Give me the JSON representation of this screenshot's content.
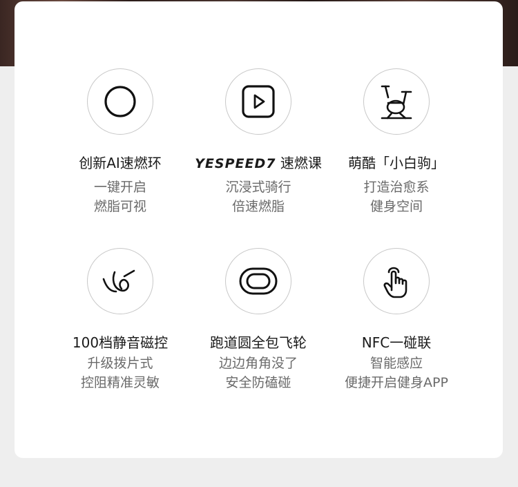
{
  "features": [
    {
      "icon": "circle-icon",
      "title": "创新AI速燃环",
      "sub1": "一键开启",
      "sub2": "燃脂可视"
    },
    {
      "icon": "play-icon",
      "title_brand": "YESPEED7",
      "title": "速燃课",
      "sub1": "沉浸式骑行",
      "sub2": "倍速燃脂"
    },
    {
      "icon": "exercise-bike-icon",
      "title": "萌酷「小白驹」",
      "sub1": "打造治愈系",
      "sub2": "健身空间"
    },
    {
      "icon": "resistance-knob-icon",
      "title": "100档静音磁控",
      "sub1": "升级拨片式",
      "sub2": "控阻精准灵敏"
    },
    {
      "icon": "track-icon",
      "title": "跑道圆全包飞轮",
      "sub1": "边边角角没了",
      "sub2": "安全防磕碰"
    },
    {
      "icon": "nfc-touch-icon",
      "title": "NFC一碰联",
      "sub1": "智能感应",
      "sub2": "便捷开启健身APP"
    }
  ],
  "colors": {
    "title": "#1a1a1a",
    "sub": "#6a6a6a",
    "circle_border": "#c8c8c8",
    "card": "#ffffff"
  }
}
